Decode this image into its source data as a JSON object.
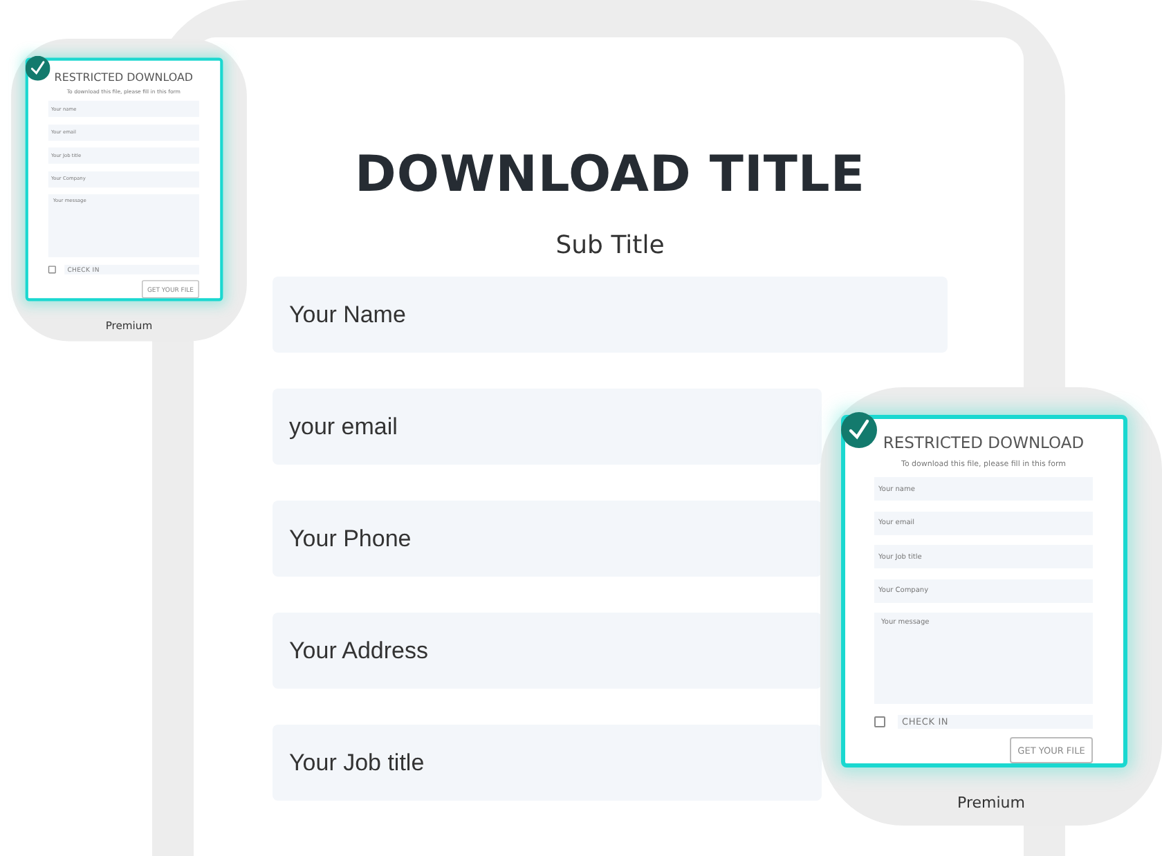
{
  "form": {
    "title": "DOWNLOAD TITLE",
    "subtitle": "Sub Title",
    "fields": [
      {
        "placeholder": "Your Name"
      },
      {
        "placeholder": "your email"
      },
      {
        "placeholder": "Your Phone"
      },
      {
        "placeholder": "Your Address"
      },
      {
        "placeholder": "Your Job title"
      }
    ]
  },
  "templates": [
    {
      "selected": true,
      "title": "RESTRICTED DOWNLOAD",
      "instruction": "To download this file, please fill in this form",
      "fields": [
        {
          "placeholder": "Your name"
        },
        {
          "placeholder": "Your email"
        },
        {
          "placeholder": "Your Job title"
        },
        {
          "placeholder": "Your Company"
        }
      ],
      "message": {
        "placeholder": "Your message"
      },
      "checkbox": {
        "checked": false,
        "label": "CHECK IN"
      },
      "button": "GET YOUR FILE",
      "caption": "Premium"
    },
    {
      "selected": true,
      "title": "RESTRICTED DOWNLOAD",
      "instruction": "To download this file, please fill in this form",
      "fields": [
        {
          "placeholder": "Your name"
        },
        {
          "placeholder": "Your email"
        },
        {
          "placeholder": "Your Job title"
        },
        {
          "placeholder": "Your Company"
        }
      ],
      "message": {
        "placeholder": "Your message"
      },
      "checkbox": {
        "checked": false,
        "label": "CHECK IN"
      },
      "button": "GET YOUR FILE",
      "caption": "Premium"
    }
  ]
}
